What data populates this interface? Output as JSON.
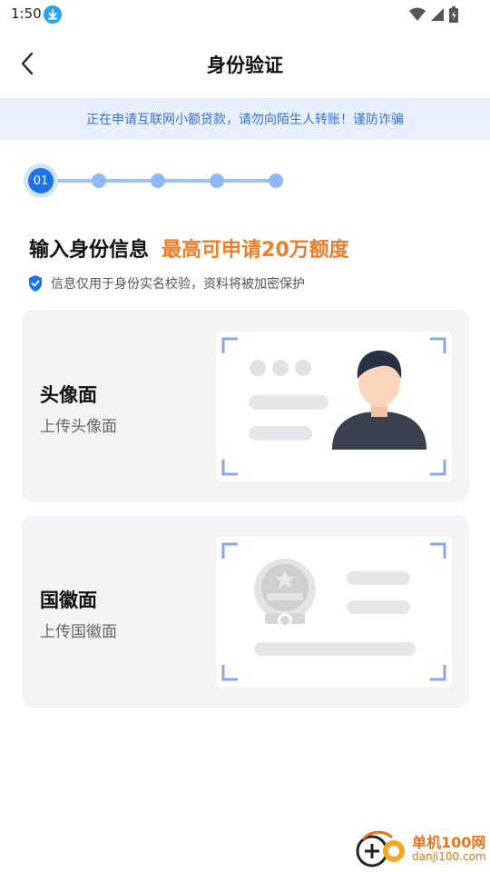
{
  "status_bar": {
    "time": "1:50",
    "download_icon": "download-icon",
    "wifi_icon": "wifi-icon",
    "signal_icon": "cell-signal-icon",
    "battery_icon": "battery-charging-icon"
  },
  "nav": {
    "title": "身份验证",
    "back_icon": "chevron-left-icon"
  },
  "banner": {
    "text": "正在申请互联网小额贷款，请勿向陌生人转账！谨防诈骗"
  },
  "stepper": {
    "active_label": "01",
    "total_steps": 5,
    "active_step": 1
  },
  "headline": {
    "main": "输入身份信息",
    "accent": "最高可申请20万额度"
  },
  "privacy": {
    "icon": "shield-check-icon",
    "text": "信息仅用于身份实名校验，资料将被加密保护"
  },
  "cards": {
    "front": {
      "title": "头像面",
      "subtitle": "上传头像面"
    },
    "back": {
      "title": "国徽面",
      "subtitle": "上传国徽面"
    }
  },
  "watermark": {
    "title": "单机100网",
    "url": "danji100.com"
  },
  "colors": {
    "primary": "#1a73e8",
    "accent": "#f07c28",
    "banner_bg": "#e8f0fd",
    "card_bg": "#f4f4f6"
  }
}
